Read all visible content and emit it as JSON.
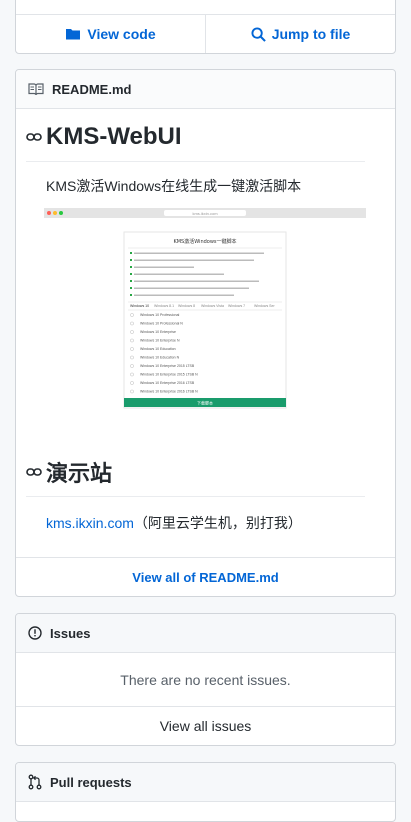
{
  "top_buttons": {
    "view_code": "View code",
    "jump_to_file": "Jump to file"
  },
  "readme": {
    "filename": "README.md",
    "title": "KMS-WebUI",
    "description": "KMS激活Windows在线生成一键激活脚本",
    "screenshot": {
      "address": "kms.ikxin.com",
      "page_title": "KMS激活Windows一键脚本",
      "tabs": [
        "Windows 10",
        "Windows 8.1",
        "Windows 8",
        "Windows Vista",
        "Windows 7",
        "Windows Ser"
      ],
      "editions": [
        "Windows 10 Professional",
        "Windows 10 Professional N",
        "Windows 10 Enterprise",
        "Windows 10 Enterprise N",
        "Windows 10 Education",
        "Windows 10 Education N",
        "Windows 10 Enterprise 2015 LTSB",
        "Windows 10 Enterprise 2015 LTSB N",
        "Windows 10 Enterprise 2016 LTSB",
        "Windows 10 Enterprise 2016 LTSB N"
      ],
      "download_label": "下载脚本"
    },
    "demo_heading": "演示站",
    "demo_link": "kms.ikxin.com",
    "demo_note": "（阿里云学生机，别打我）",
    "view_all": "View all of README.md"
  },
  "issues": {
    "header": "Issues",
    "empty_text": "There are no recent issues.",
    "view_all": "View all issues"
  },
  "pull_requests": {
    "header": "Pull requests"
  },
  "colors": {
    "link": "#0366d6",
    "border": "#d1d5da",
    "green": "#28a745"
  }
}
